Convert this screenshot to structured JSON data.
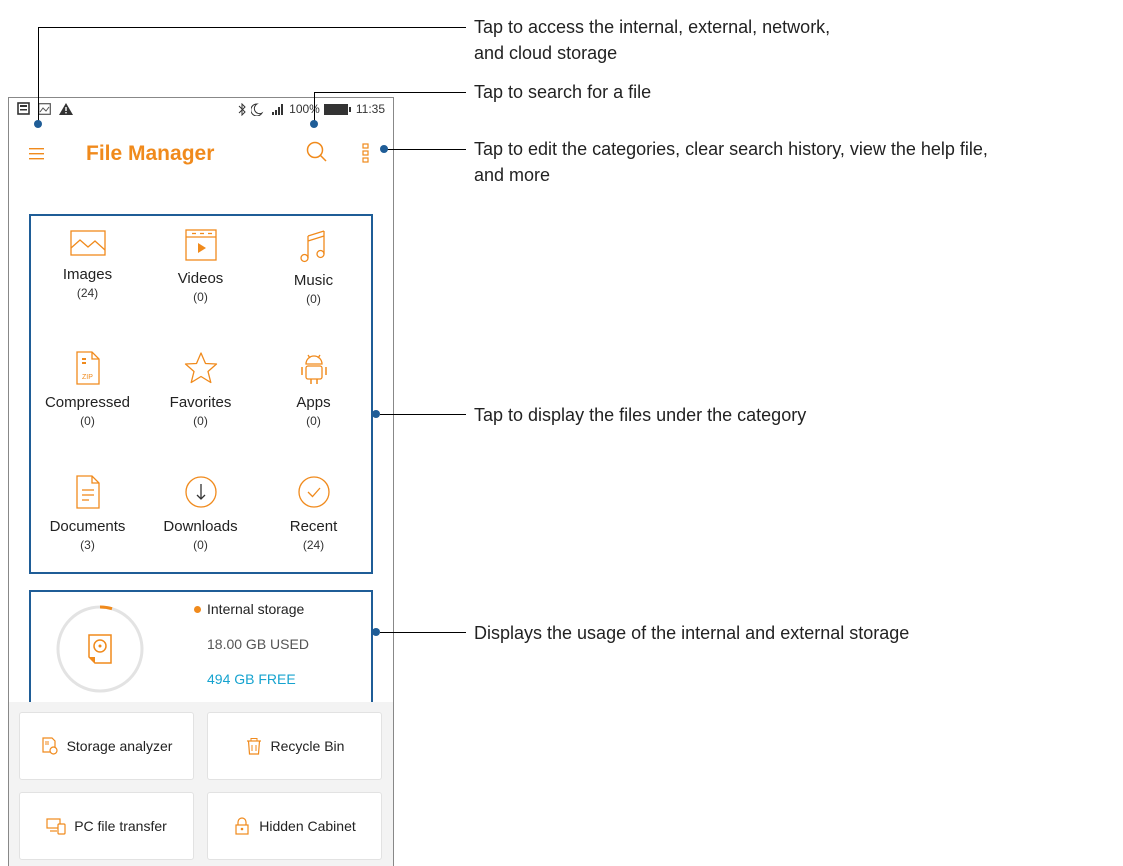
{
  "status_bar": {
    "battery": "100%",
    "time": "11:35"
  },
  "app": {
    "title": "File Manager"
  },
  "categories": [
    {
      "label": "Images",
      "count": "(24)"
    },
    {
      "label": "Videos",
      "count": "(0)"
    },
    {
      "label": "Music",
      "count": "(0)"
    },
    {
      "label": "Compressed",
      "count": "(0)"
    },
    {
      "label": "Favorites",
      "count": "(0)"
    },
    {
      "label": "Apps",
      "count": "(0)"
    },
    {
      "label": "Documents",
      "count": "(3)"
    },
    {
      "label": "Downloads",
      "count": "(0)"
    },
    {
      "label": "Recent",
      "count": "(24)"
    }
  ],
  "storage": {
    "name": "Internal storage",
    "used": "18.00 GB USED",
    "free": "494 GB FREE"
  },
  "tools": [
    {
      "label": "Storage analyzer"
    },
    {
      "label": "Recycle Bin"
    },
    {
      "label": "PC file transfer"
    },
    {
      "label": "Hidden Cabinet"
    }
  ],
  "callouts": {
    "menu_line1": "Tap to access the internal, external, network,",
    "menu_line2": "and cloud storage",
    "search": "Tap to search for a file",
    "more_line1": "Tap to edit the categories, clear search history, view the help file,",
    "more_line2": "and more",
    "categories": "Tap to display the files under the category",
    "storage": "Displays the usage of the internal and external storage"
  },
  "colors": {
    "accent": "#f08a1c",
    "callout_box": "#1f5d97",
    "free_text": "#16a3cf"
  }
}
